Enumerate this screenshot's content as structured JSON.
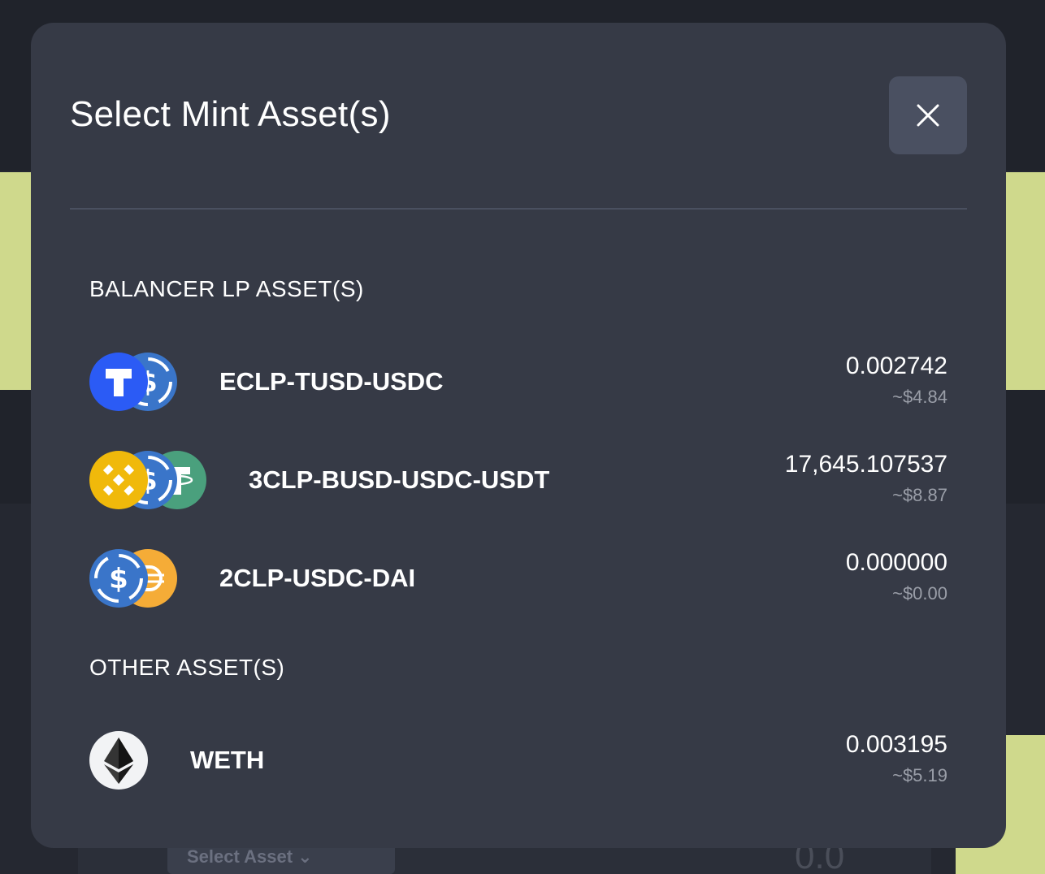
{
  "modal": {
    "title": "Select Mint Asset(s)"
  },
  "sections": {
    "lp_label": "BALANCER LP ASSET(S)",
    "other_label": "OTHER ASSET(S)"
  },
  "lp_assets": [
    {
      "name": "ECLP-TUSD-USDC",
      "amount": "0.002742",
      "usd": "~$4.84",
      "icons": [
        "tusd-icon",
        "usdc-icon"
      ]
    },
    {
      "name": "3CLP-BUSD-USDC-USDT",
      "amount": "17,645.107537",
      "usd": "~$8.87",
      "icons": [
        "busd-icon",
        "usdc-icon",
        "usdt-icon"
      ]
    },
    {
      "name": "2CLP-USDC-DAI",
      "amount": "0.000000",
      "usd": "~$0.00",
      "icons": [
        "usdc-icon",
        "dai-icon"
      ]
    }
  ],
  "other_assets": [
    {
      "name": "WETH",
      "amount": "0.003195",
      "usd": "~$5.19",
      "icons": [
        "eth-icon"
      ]
    }
  ],
  "background": {
    "select_asset_label": "Select Asset",
    "amount_placeholder": "0.0"
  },
  "colors": {
    "modal_bg": "#363a46",
    "close_button_bg": "#4a5061",
    "usd_text": "#9a9ea8",
    "tusd_blue": "#2b5bf5",
    "usdc_blue": "#3a75c9",
    "busd_yellow": "#f0b90b",
    "usdt_green": "#4aa07d",
    "dai_yellow": "#f5ac37"
  }
}
